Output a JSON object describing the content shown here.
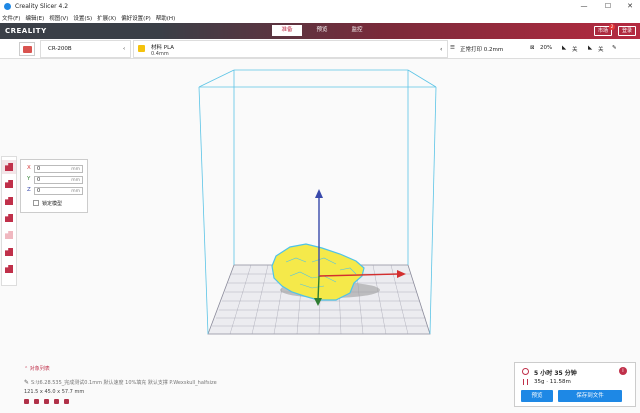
{
  "window": {
    "title": "Creality Slicer 4.2",
    "minimize": "—",
    "maximize": "☐",
    "close": "✕"
  },
  "menu": [
    "文件(F)",
    "编辑(E)",
    "视图(V)",
    "设置(S)",
    "扩展(X)",
    "偏好设置(P)",
    "帮助(H)"
  ],
  "header": {
    "logo": "CREALITY",
    "tabs": [
      "准备",
      "预览",
      "监控"
    ],
    "active_tab": "准备",
    "btn_right1": "市场",
    "btn_right2": "登录",
    "badge_count": "2"
  },
  "toolbar": {
    "printer": "CR-200B",
    "printer_chevron": "‹",
    "material_label": "材料 PLA",
    "material_size": "0.4mm",
    "material_chevron": "‹",
    "profile": "正常打印 0.2mm",
    "infill": "20%",
    "support": "关",
    "adhesion": "关"
  },
  "transform": {
    "x": {
      "axis": "X",
      "value": "0",
      "unit": "mm"
    },
    "y": {
      "axis": "Y",
      "value": "0",
      "unit": "mm"
    },
    "z": {
      "axis": "Z",
      "value": "0",
      "unit": "mm"
    },
    "lock_label": "锁定模型"
  },
  "objects": {
    "title": "对象列表",
    "file": "S:\\t6.28.535_完成测试0.1mm 默认速度 10%填充 默认支撑 P.Wexskull_halfsize",
    "dimensions": "121.5 x 45.0 x 57.7 mm"
  },
  "estimate": {
    "time": "5 小时 35 分钟",
    "material": "35g · 11.58m",
    "info": "i",
    "preview_button": "预览",
    "save_button": "保存到文件"
  },
  "colors": {
    "accent": "#c0304a",
    "model": "#f5e94a",
    "model_outline": "#4fc3e8",
    "build_volume": "#5cc4e6",
    "x_axis": "#d32f2f",
    "y_axis": "#2e7d32",
    "z_axis": "#3949ab",
    "button": "#1e88e5"
  }
}
